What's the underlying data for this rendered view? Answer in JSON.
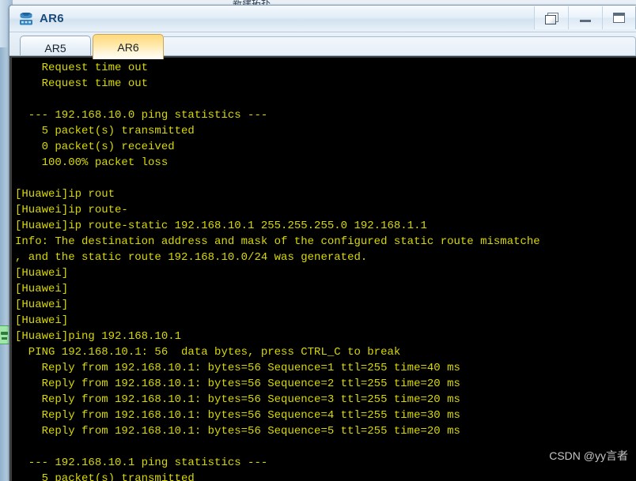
{
  "desktop": {
    "background_window_title": "新建拓扑"
  },
  "window": {
    "title": "AR6",
    "icon": "router-icon",
    "controls": {
      "restore_label": "",
      "minimize_label": "",
      "maximize_label": ""
    }
  },
  "tabs": [
    {
      "label": "AR5",
      "active": false
    },
    {
      "label": "AR6",
      "active": true
    }
  ],
  "terminal": {
    "foreground_color": "#d9d900",
    "background_color": "#000000",
    "lines": [
      "    Request time out",
      "    Request time out",
      "",
      "  --- 192.168.10.0 ping statistics ---",
      "    5 packet(s) transmitted",
      "    0 packet(s) received",
      "    100.00% packet loss",
      "",
      "[Huawei]ip rout",
      "[Huawei]ip route-",
      "[Huawei]ip route-static 192.168.10.1 255.255.255.0 192.168.1.1",
      "Info: The destination address and mask of the configured static route mismatche",
      ", and the static route 192.168.10.0/24 was generated.",
      "[Huawei]",
      "[Huawei]",
      "[Huawei]",
      "[Huawei]",
      "[Huawei]ping 192.168.10.1",
      "  PING 192.168.10.1: 56  data bytes, press CTRL_C to break",
      "    Reply from 192.168.10.1: bytes=56 Sequence=1 ttl=255 time=40 ms",
      "    Reply from 192.168.10.1: bytes=56 Sequence=2 ttl=255 time=20 ms",
      "    Reply from 192.168.10.1: bytes=56 Sequence=3 ttl=255 time=20 ms",
      "    Reply from 192.168.10.1: bytes=56 Sequence=4 ttl=255 time=30 ms",
      "    Reply from 192.168.10.1: bytes=56 Sequence=5 ttl=255 time=20 ms",
      "",
      "  --- 192.168.10.1 ping statistics ---",
      "    5 packet(s) transmitted"
    ]
  },
  "watermark": {
    "text": "CSDN @yy言者"
  }
}
